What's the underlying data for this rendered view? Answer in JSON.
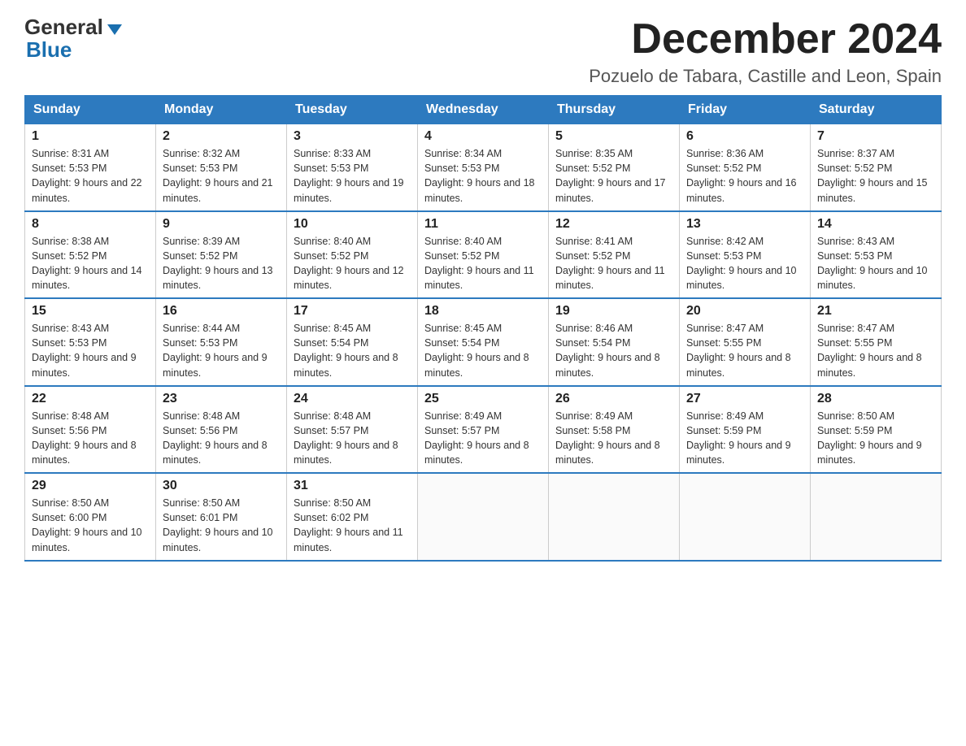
{
  "logo": {
    "general": "General",
    "blue": "Blue"
  },
  "header": {
    "month": "December 2024",
    "location": "Pozuelo de Tabara, Castille and Leon, Spain"
  },
  "days_of_week": [
    "Sunday",
    "Monday",
    "Tuesday",
    "Wednesday",
    "Thursday",
    "Friday",
    "Saturday"
  ],
  "weeks": [
    [
      {
        "day": "1",
        "sunrise": "8:31 AM",
        "sunset": "5:53 PM",
        "daylight": "9 hours and 22 minutes."
      },
      {
        "day": "2",
        "sunrise": "8:32 AM",
        "sunset": "5:53 PM",
        "daylight": "9 hours and 21 minutes."
      },
      {
        "day": "3",
        "sunrise": "8:33 AM",
        "sunset": "5:53 PM",
        "daylight": "9 hours and 19 minutes."
      },
      {
        "day": "4",
        "sunrise": "8:34 AM",
        "sunset": "5:53 PM",
        "daylight": "9 hours and 18 minutes."
      },
      {
        "day": "5",
        "sunrise": "8:35 AM",
        "sunset": "5:52 PM",
        "daylight": "9 hours and 17 minutes."
      },
      {
        "day": "6",
        "sunrise": "8:36 AM",
        "sunset": "5:52 PM",
        "daylight": "9 hours and 16 minutes."
      },
      {
        "day": "7",
        "sunrise": "8:37 AM",
        "sunset": "5:52 PM",
        "daylight": "9 hours and 15 minutes."
      }
    ],
    [
      {
        "day": "8",
        "sunrise": "8:38 AM",
        "sunset": "5:52 PM",
        "daylight": "9 hours and 14 minutes."
      },
      {
        "day": "9",
        "sunrise": "8:39 AM",
        "sunset": "5:52 PM",
        "daylight": "9 hours and 13 minutes."
      },
      {
        "day": "10",
        "sunrise": "8:40 AM",
        "sunset": "5:52 PM",
        "daylight": "9 hours and 12 minutes."
      },
      {
        "day": "11",
        "sunrise": "8:40 AM",
        "sunset": "5:52 PM",
        "daylight": "9 hours and 11 minutes."
      },
      {
        "day": "12",
        "sunrise": "8:41 AM",
        "sunset": "5:52 PM",
        "daylight": "9 hours and 11 minutes."
      },
      {
        "day": "13",
        "sunrise": "8:42 AM",
        "sunset": "5:53 PM",
        "daylight": "9 hours and 10 minutes."
      },
      {
        "day": "14",
        "sunrise": "8:43 AM",
        "sunset": "5:53 PM",
        "daylight": "9 hours and 10 minutes."
      }
    ],
    [
      {
        "day": "15",
        "sunrise": "8:43 AM",
        "sunset": "5:53 PM",
        "daylight": "9 hours and 9 minutes."
      },
      {
        "day": "16",
        "sunrise": "8:44 AM",
        "sunset": "5:53 PM",
        "daylight": "9 hours and 9 minutes."
      },
      {
        "day": "17",
        "sunrise": "8:45 AM",
        "sunset": "5:54 PM",
        "daylight": "9 hours and 8 minutes."
      },
      {
        "day": "18",
        "sunrise": "8:45 AM",
        "sunset": "5:54 PM",
        "daylight": "9 hours and 8 minutes."
      },
      {
        "day": "19",
        "sunrise": "8:46 AM",
        "sunset": "5:54 PM",
        "daylight": "9 hours and 8 minutes."
      },
      {
        "day": "20",
        "sunrise": "8:47 AM",
        "sunset": "5:55 PM",
        "daylight": "9 hours and 8 minutes."
      },
      {
        "day": "21",
        "sunrise": "8:47 AM",
        "sunset": "5:55 PM",
        "daylight": "9 hours and 8 minutes."
      }
    ],
    [
      {
        "day": "22",
        "sunrise": "8:48 AM",
        "sunset": "5:56 PM",
        "daylight": "9 hours and 8 minutes."
      },
      {
        "day": "23",
        "sunrise": "8:48 AM",
        "sunset": "5:56 PM",
        "daylight": "9 hours and 8 minutes."
      },
      {
        "day": "24",
        "sunrise": "8:48 AM",
        "sunset": "5:57 PM",
        "daylight": "9 hours and 8 minutes."
      },
      {
        "day": "25",
        "sunrise": "8:49 AM",
        "sunset": "5:57 PM",
        "daylight": "9 hours and 8 minutes."
      },
      {
        "day": "26",
        "sunrise": "8:49 AM",
        "sunset": "5:58 PM",
        "daylight": "9 hours and 8 minutes."
      },
      {
        "day": "27",
        "sunrise": "8:49 AM",
        "sunset": "5:59 PM",
        "daylight": "9 hours and 9 minutes."
      },
      {
        "day": "28",
        "sunrise": "8:50 AM",
        "sunset": "5:59 PM",
        "daylight": "9 hours and 9 minutes."
      }
    ],
    [
      {
        "day": "29",
        "sunrise": "8:50 AM",
        "sunset": "6:00 PM",
        "daylight": "9 hours and 10 minutes."
      },
      {
        "day": "30",
        "sunrise": "8:50 AM",
        "sunset": "6:01 PM",
        "daylight": "9 hours and 10 minutes."
      },
      {
        "day": "31",
        "sunrise": "8:50 AM",
        "sunset": "6:02 PM",
        "daylight": "9 hours and 11 minutes."
      },
      null,
      null,
      null,
      null
    ]
  ]
}
